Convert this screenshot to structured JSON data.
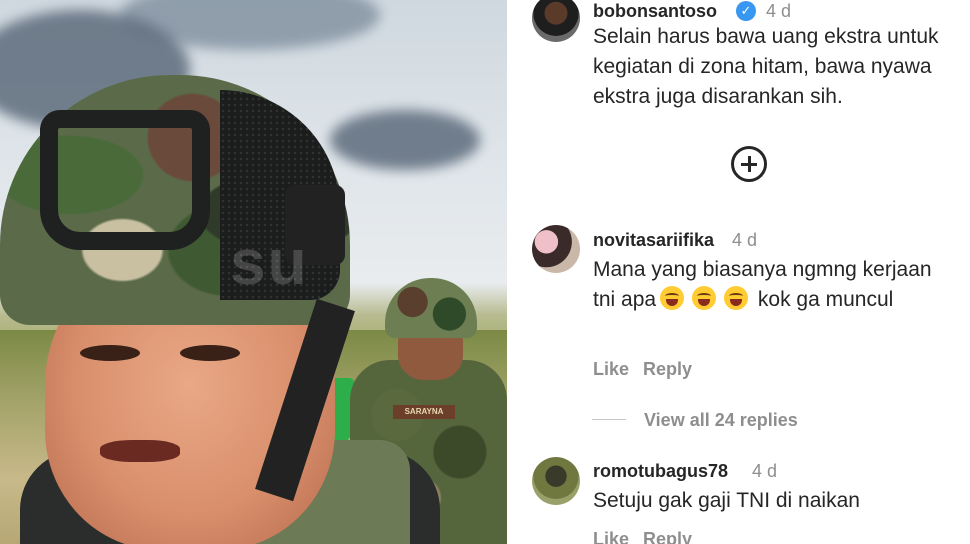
{
  "video": {
    "watermark": "su",
    "name_tag": "SARAYNA"
  },
  "comments": [
    {
      "username": "bobonsantoso",
      "verified": true,
      "time": "4 d",
      "text": "Selain harus bawa uang ekstra untuk kegiatan di zona hitam, bawa nyawa ekstra juga disarankan sih."
    },
    {
      "username": "novitasariifika",
      "time": "4 d",
      "text_parts": [
        "Mana yang biasanya ngmng kerjaan tni apa",
        "kok ga muncul"
      ],
      "emoji_count": 3,
      "emoji_name": "laughing-with-tears-emoji",
      "like_label": "Like",
      "reply_label": "Reply",
      "view_replies_label": "View all 24 replies"
    },
    {
      "username": "romotubagus78",
      "time": "4 d",
      "text": "Setuju gak gaji TNI di naikan",
      "like_label": "Like",
      "reply_label": "Reply"
    }
  ],
  "icons": {
    "load_more": "plus-circle-icon",
    "verified": "verified-badge-icon"
  },
  "colors": {
    "verified_blue": "#3897f0",
    "secondary_text": "#8e8e8e",
    "primary_text": "#262626"
  }
}
